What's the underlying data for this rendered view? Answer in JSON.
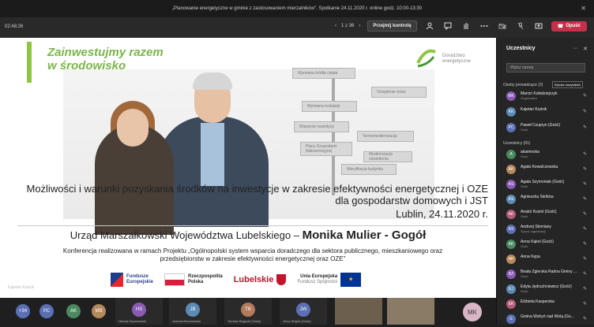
{
  "window": {
    "title": "„Planowanie energetyczne w gminie z zastosowaniem mierzalników\". Spotkanie 24.11.2020 r. online godz. 10:00-13:30",
    "close_glyph": "✕"
  },
  "toolbar": {
    "timer": "02:48:26",
    "pager_prev": "‹",
    "pager": "1 z 36",
    "pager_next": "›",
    "take_control": "Przejmij kontrolę",
    "leave_label": "Opuść"
  },
  "slide": {
    "title_line1": "Zainwestujmy razem",
    "title_line2": "w środowisko",
    "logo_line1": "Doradztwo",
    "logo_line2": "energetyczne",
    "signs": [
      "Wymiana źródła ciepła",
      "Ocieplenie ścian",
      "Wymiana instalacji",
      "Wsparcie inwestycji",
      "Termomodernizacja",
      "Plany Gospodarki Niskoemisyjnej",
      "Modernizacja oświetlenia",
      "Weryfikacja budynku"
    ],
    "subtitle": "Możliwości i warunki pozyskania środków na inwestycje w zakresie efektywności energetycznej i OZE dla gospodarstw domowych i JST",
    "date": "Lublin, 24.11.2020 r.",
    "office": "Urząd Marszałkowski Województwa Lubelskiego –",
    "presenter": "Monika Mulier - Gogół",
    "conference": "Konferencja realizowana w ramach Projektu „Ogólnopolski system wsparcia doradczego dla sektora publicznego, mieszkaniowego oraz przedsiębiorstw w zakresie efektywności energetycznej oraz OZE\"",
    "logo_fe_1": "Fundusze",
    "logo_fe_2": "Europejskie",
    "logo_rp_1": "Rzeczpospolita",
    "logo_rp_2": "Polska",
    "logo_lub": "Lubelskie",
    "logo_eu_1": "Unia Europejska",
    "logo_eu_2": "Fundusz Spójności",
    "presenter_tag": "Kajetan Kuścik"
  },
  "strip": {
    "count": "+34",
    "avatars": [
      {
        "initials": "PC",
        "color": "#5b6fb5"
      },
      {
        "initials": "AK",
        "color": "#4b8a5e"
      },
      {
        "initials": "MB",
        "color": "#b5895b"
      }
    ],
    "tiles": [
      {
        "initials": "HS",
        "name": "Henryk Sęczkowski",
        "color": "#8a5bb5"
      },
      {
        "initials": "JB",
        "name": "Joanna Brzozowska",
        "color": "#5b8ab5"
      },
      {
        "initials": "TB",
        "name": "Tomasz Bogucki (Gość)",
        "color": "#b57a5b"
      },
      {
        "initials": "JW",
        "name": "Jerzy Wójcik (Gość)",
        "color": "#5b6fb5"
      }
    ],
    "last_initials": "MK"
  },
  "panel": {
    "title": "Uczestnicy",
    "search_placeholder": "Wpisz nazwę",
    "section_presenters": "Osoby prowadzące (3)",
    "mute_all": "Wycisz wszystkich",
    "section_attendees": "Uczestnicy (81)",
    "presenters": [
      {
        "name": "Marcin Kołodziejczyk",
        "role": "Organizator",
        "color": "#8a5bb5",
        "initials": "MK"
      },
      {
        "name": "Kajetan Kuścik",
        "role": "",
        "color": "#5b8ab5",
        "initials": "KK"
      },
      {
        "name": "Paweł Czupryn (Gość)",
        "role": "Gość",
        "color": "#5b6fb5",
        "initials": "PC"
      }
    ],
    "attendees": [
      {
        "name": "akaminska",
        "role": "Gość",
        "color": "#4b8a5e",
        "initials": "A"
      },
      {
        "name": "Agata Kowalczewska",
        "role": "",
        "color": "#b5895b",
        "initials": "AK"
      },
      {
        "name": "Agata Szymoniak (Gość)",
        "role": "Gość",
        "color": "#8a5bb5",
        "initials": "AS"
      },
      {
        "name": "Agnieszka Sielicka",
        "role": "",
        "color": "#5b8ab5",
        "initials": "AS"
      },
      {
        "name": "Anatol Kozieł (Gość)",
        "role": "Gość",
        "color": "#b55b7a",
        "initials": "AK"
      },
      {
        "name": "Andrzej Słomiany",
        "role": "Spoza organizacji",
        "color": "#5b6fb5",
        "initials": "AS"
      },
      {
        "name": "Anna Kąkol (Gość)",
        "role": "Gość",
        "color": "#4b8a5e",
        "initials": "AK"
      },
      {
        "name": "Anna Kępa",
        "role": "",
        "color": "#b5895b",
        "initials": "AK"
      },
      {
        "name": "Beata Zgierska Radna Gminy ...",
        "role": "Gość",
        "color": "#8a5bb5",
        "initials": "BZ"
      },
      {
        "name": "Edyta Jędruchniewicz (Gość)",
        "role": "Gość",
        "color": "#5b8ab5",
        "initials": "EJ"
      },
      {
        "name": "Elżbieta Kasperska",
        "role": "",
        "color": "#b55b7a",
        "initials": "EK"
      },
      {
        "name": "Gmina Wohyń nad Wolą (Go...",
        "role": "",
        "color": "#5b6fb5",
        "initials": "G"
      }
    ]
  }
}
